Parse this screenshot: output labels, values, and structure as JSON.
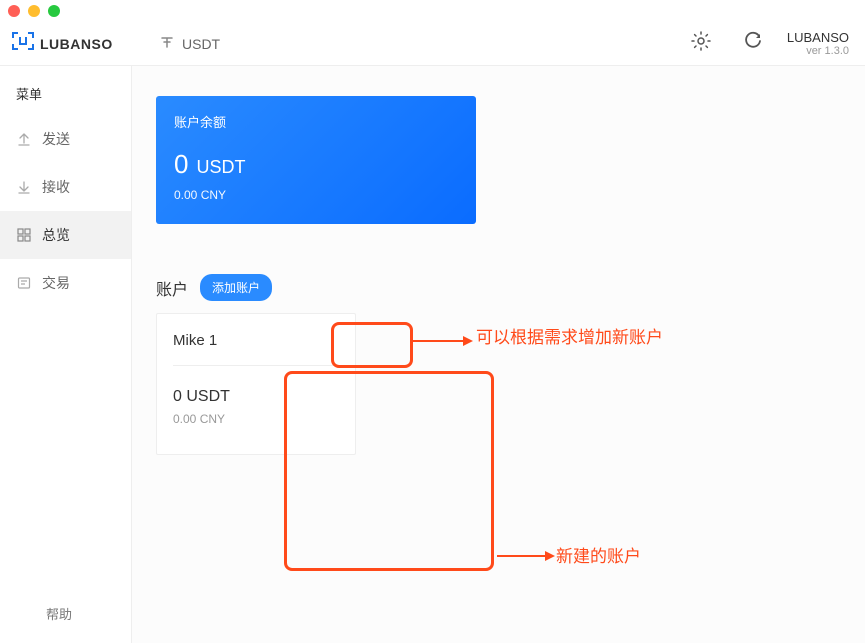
{
  "header": {
    "logo_text": "LUBANSO",
    "currency": "USDT",
    "app_name": "LUBANSO",
    "version": "ver 1.3.0"
  },
  "sidebar": {
    "menu_title": "菜单",
    "items": [
      {
        "label": "发送",
        "icon": "upload-icon"
      },
      {
        "label": "接收",
        "icon": "download-icon"
      },
      {
        "label": "总览",
        "icon": "overview-icon"
      },
      {
        "label": "交易",
        "icon": "transaction-icon"
      }
    ],
    "help_label": "帮助"
  },
  "balance": {
    "label": "账户余额",
    "amount": "0",
    "currency": "USDT",
    "sub": "0.00 CNY"
  },
  "accounts": {
    "title": "账户",
    "add_button": "添加账户"
  },
  "account_card": {
    "name": "Mike 1",
    "balance": "0 USDT",
    "sub": "0.00 CNY"
  },
  "annotations": {
    "text1": "可以根据需求增加新账户",
    "text2": "新建的账户"
  }
}
